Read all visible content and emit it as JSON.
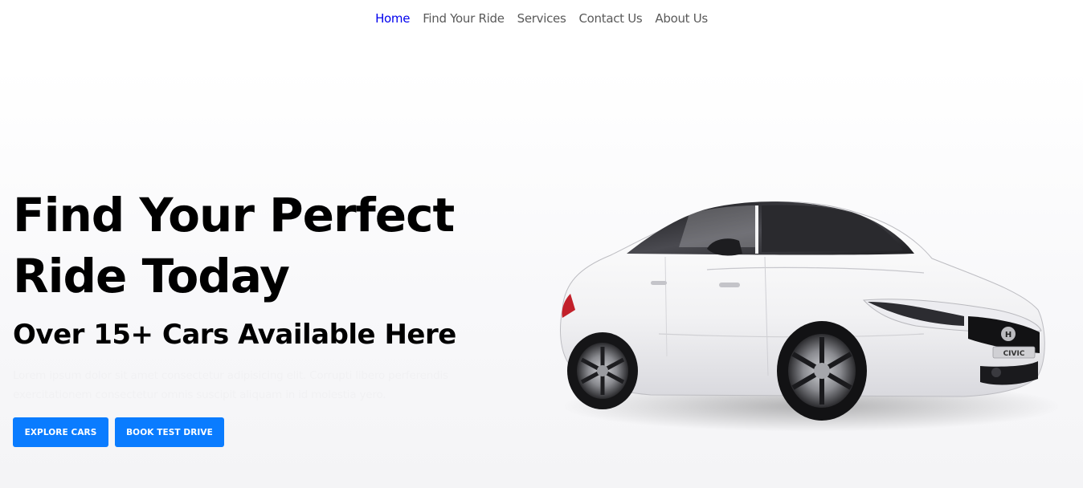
{
  "nav": {
    "items": [
      {
        "label": "Home",
        "active": true
      },
      {
        "label": "Find Your Ride",
        "active": false
      },
      {
        "label": "Services",
        "active": false
      },
      {
        "label": "Contact Us",
        "active": false
      },
      {
        "label": "About Us",
        "active": false
      }
    ]
  },
  "hero": {
    "title": "Find Your Perfect Ride Today",
    "subtitle": "Over 15+ Cars Available Here",
    "text": "Lorem ipsum dolor sit amet consectetur adipisicing elit. Corrupti libero perferendis exercitationem consectetur omnis suscipit aliquam in id molestia yero.",
    "explore_label": "EXPLORE CARS",
    "book_label": "BOOK TEST DRIVE",
    "car_badge": "CIVIC"
  },
  "colors": {
    "accent": "#0a7cff",
    "nav_active": "#0000ee",
    "nav_text": "#5a5a5a"
  }
}
